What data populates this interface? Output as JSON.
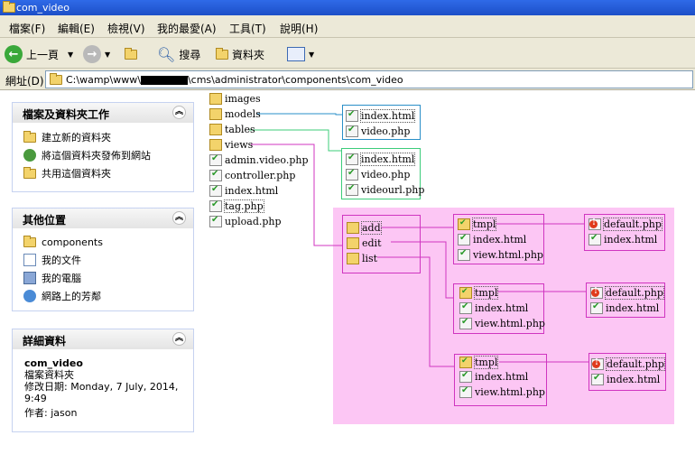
{
  "window": {
    "title": "com_video"
  },
  "menu": [
    "檔案(F)",
    "編輯(E)",
    "檢視(V)",
    "我的最愛(A)",
    "工具(T)",
    "說明(H)"
  ],
  "toolbar": {
    "back": "上一頁",
    "search": "搜尋",
    "folders": "資料夾"
  },
  "address": {
    "label": "網址(D)",
    "prefix": "C:\\wamp\\www\\",
    "suffix": "\\cms\\administrator\\components\\com_video"
  },
  "tasks": {
    "header": "檔案及資料夾工作",
    "items": [
      "建立新的資料夾",
      "將這個資料夾發佈到網站",
      "共用這個資料夾"
    ]
  },
  "places": {
    "header": "其他位置",
    "items": [
      "components",
      "我的文件",
      "我的電腦",
      "網路上的芳鄰"
    ]
  },
  "details": {
    "header": "詳細資料",
    "name": "com_video",
    "type": "檔案資料夾",
    "modified": "修改日期: Monday, 7 July, 2014,",
    "modified_time": "9:49",
    "author": "作者: jason"
  },
  "files": [
    "images",
    "models",
    "tables",
    "views",
    "admin.video.php",
    "controller.php",
    "index.html",
    "tag.php",
    "upload.php"
  ],
  "models_box": [
    "index.html",
    "video.php"
  ],
  "tables_box": [
    "index.html",
    "video.php",
    "videourl.php"
  ],
  "views_box": [
    "add",
    "edit",
    "list"
  ],
  "tmpl_groups": [
    {
      "items": [
        "tmpl",
        "index.html",
        "view.html.php"
      ],
      "tmpl_files": [
        "default.php",
        "index.html"
      ]
    },
    {
      "items": [
        "tmpl",
        "index.html",
        "view.html.php"
      ],
      "tmpl_files": [
        "default.php",
        "index.html"
      ]
    },
    {
      "items": [
        "tmpl",
        "index.html",
        "view.html.php"
      ],
      "tmpl_files": [
        "default.php",
        "index.html"
      ]
    }
  ],
  "colors": {
    "models_line": "#2a8fc8",
    "tables_line": "#3ccc7a",
    "views_line": "#d035c0",
    "tmpl_box": "#d035c0",
    "highlight_bg": "#fcc6f4"
  }
}
